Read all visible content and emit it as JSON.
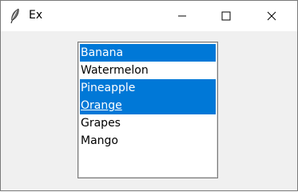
{
  "window": {
    "title": "Ex"
  },
  "controls": {
    "minimize": "minimize-icon",
    "maximize": "maximize-icon",
    "close": "close-icon"
  },
  "listbox": {
    "items": [
      {
        "label": "Banana",
        "selected": true
      },
      {
        "label": "Watermelon",
        "selected": false
      },
      {
        "label": "Pineapple",
        "selected": true
      },
      {
        "label": "Orange",
        "selected": true,
        "active": true
      },
      {
        "label": "Grapes",
        "selected": false
      },
      {
        "label": "Mango",
        "selected": false
      }
    ]
  },
  "colors": {
    "selection": "#0078d7",
    "titlebar": "#ffffff",
    "window": "#f0f0f0"
  }
}
